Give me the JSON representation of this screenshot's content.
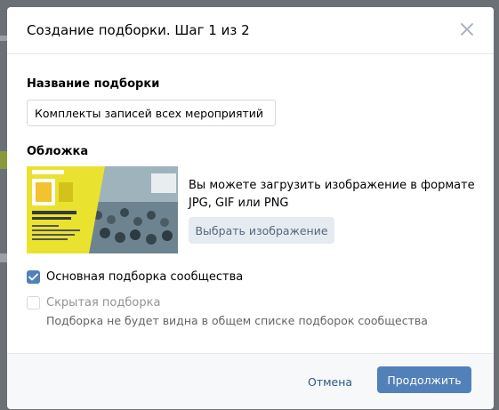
{
  "dialog": {
    "title": "Создание подборки. Шаг 1 из 2"
  },
  "name_section": {
    "label": "Название подборки",
    "value": "Комплекты записей всех мероприятий"
  },
  "cover_section": {
    "label": "Обложка",
    "hint_text": "Вы можете загрузить изображение в формате JPG, GIF или PNG",
    "choose_button": "Выбрать изображение"
  },
  "options": {
    "main_collection": {
      "label": "Основная подборка сообщества",
      "checked": true
    },
    "hidden_collection": {
      "label": "Скрытая подборка",
      "checked": false,
      "disabled": true,
      "hint": "Подборка не будет видна в общем списке подборок сообщества"
    }
  },
  "footer": {
    "cancel_label": "Отмена",
    "continue_label": "Продолжить"
  },
  "icons": {
    "close": "close-icon",
    "checkmark": "checkmark-icon"
  },
  "colors": {
    "accent": "#5181b8",
    "link": "#2a5885",
    "secondary_button_bg": "#e5ebf1",
    "footer_bg": "#f7f8fa"
  }
}
